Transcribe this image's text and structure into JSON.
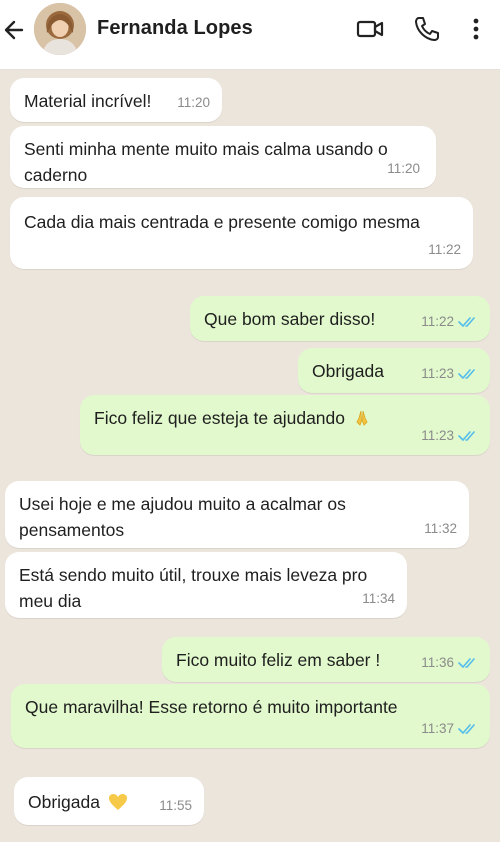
{
  "header": {
    "contact_name": "Fernanda Lopes",
    "icons": [
      "back-arrow-icon",
      "video-call-icon",
      "phone-call-icon",
      "more-options-icon"
    ]
  },
  "messages": [
    {
      "dir": "in",
      "text": "Material incrível!",
      "time": "11:20"
    },
    {
      "dir": "in",
      "text": "Senti minha mente muito mais calma usando o caderno",
      "time": "11:20"
    },
    {
      "dir": "in",
      "text": "Cada dia mais centrada e presente comigo mesma",
      "time": "11:22"
    },
    {
      "dir": "out",
      "text": "Que bom saber disso!",
      "time": "11:22",
      "status": "read"
    },
    {
      "dir": "out",
      "text": "Obrigada",
      "time": "11:23",
      "status": "read"
    },
    {
      "dir": "out",
      "text": "Fico feliz que esteja te ajudando",
      "time": "11:23",
      "status": "read",
      "emoji": "praying-hands-icon"
    },
    {
      "dir": "in",
      "text": "Usei hoje e me ajudou muito a acalmar os pensamentos",
      "time": "11:32"
    },
    {
      "dir": "in",
      "text": "Está sendo muito útil, trouxe mais leveza pro meu dia",
      "time": "11:34"
    },
    {
      "dir": "out",
      "text": "Fico muito feliz em saber !",
      "time": "11:36",
      "status": "read"
    },
    {
      "dir": "out",
      "text": "Que maravilha! Esse retorno é muito importante",
      "time": "11:37",
      "status": "read"
    },
    {
      "dir": "in",
      "text": "Obrigada",
      "time": "11:55",
      "emoji": "yellow-heart-icon"
    }
  ],
  "colors": {
    "incoming_bubble": "#ffffff",
    "outgoing_bubble": "#e1f9cc",
    "chat_background": "#ece5dc",
    "read_ticks": "#53bdeb"
  }
}
